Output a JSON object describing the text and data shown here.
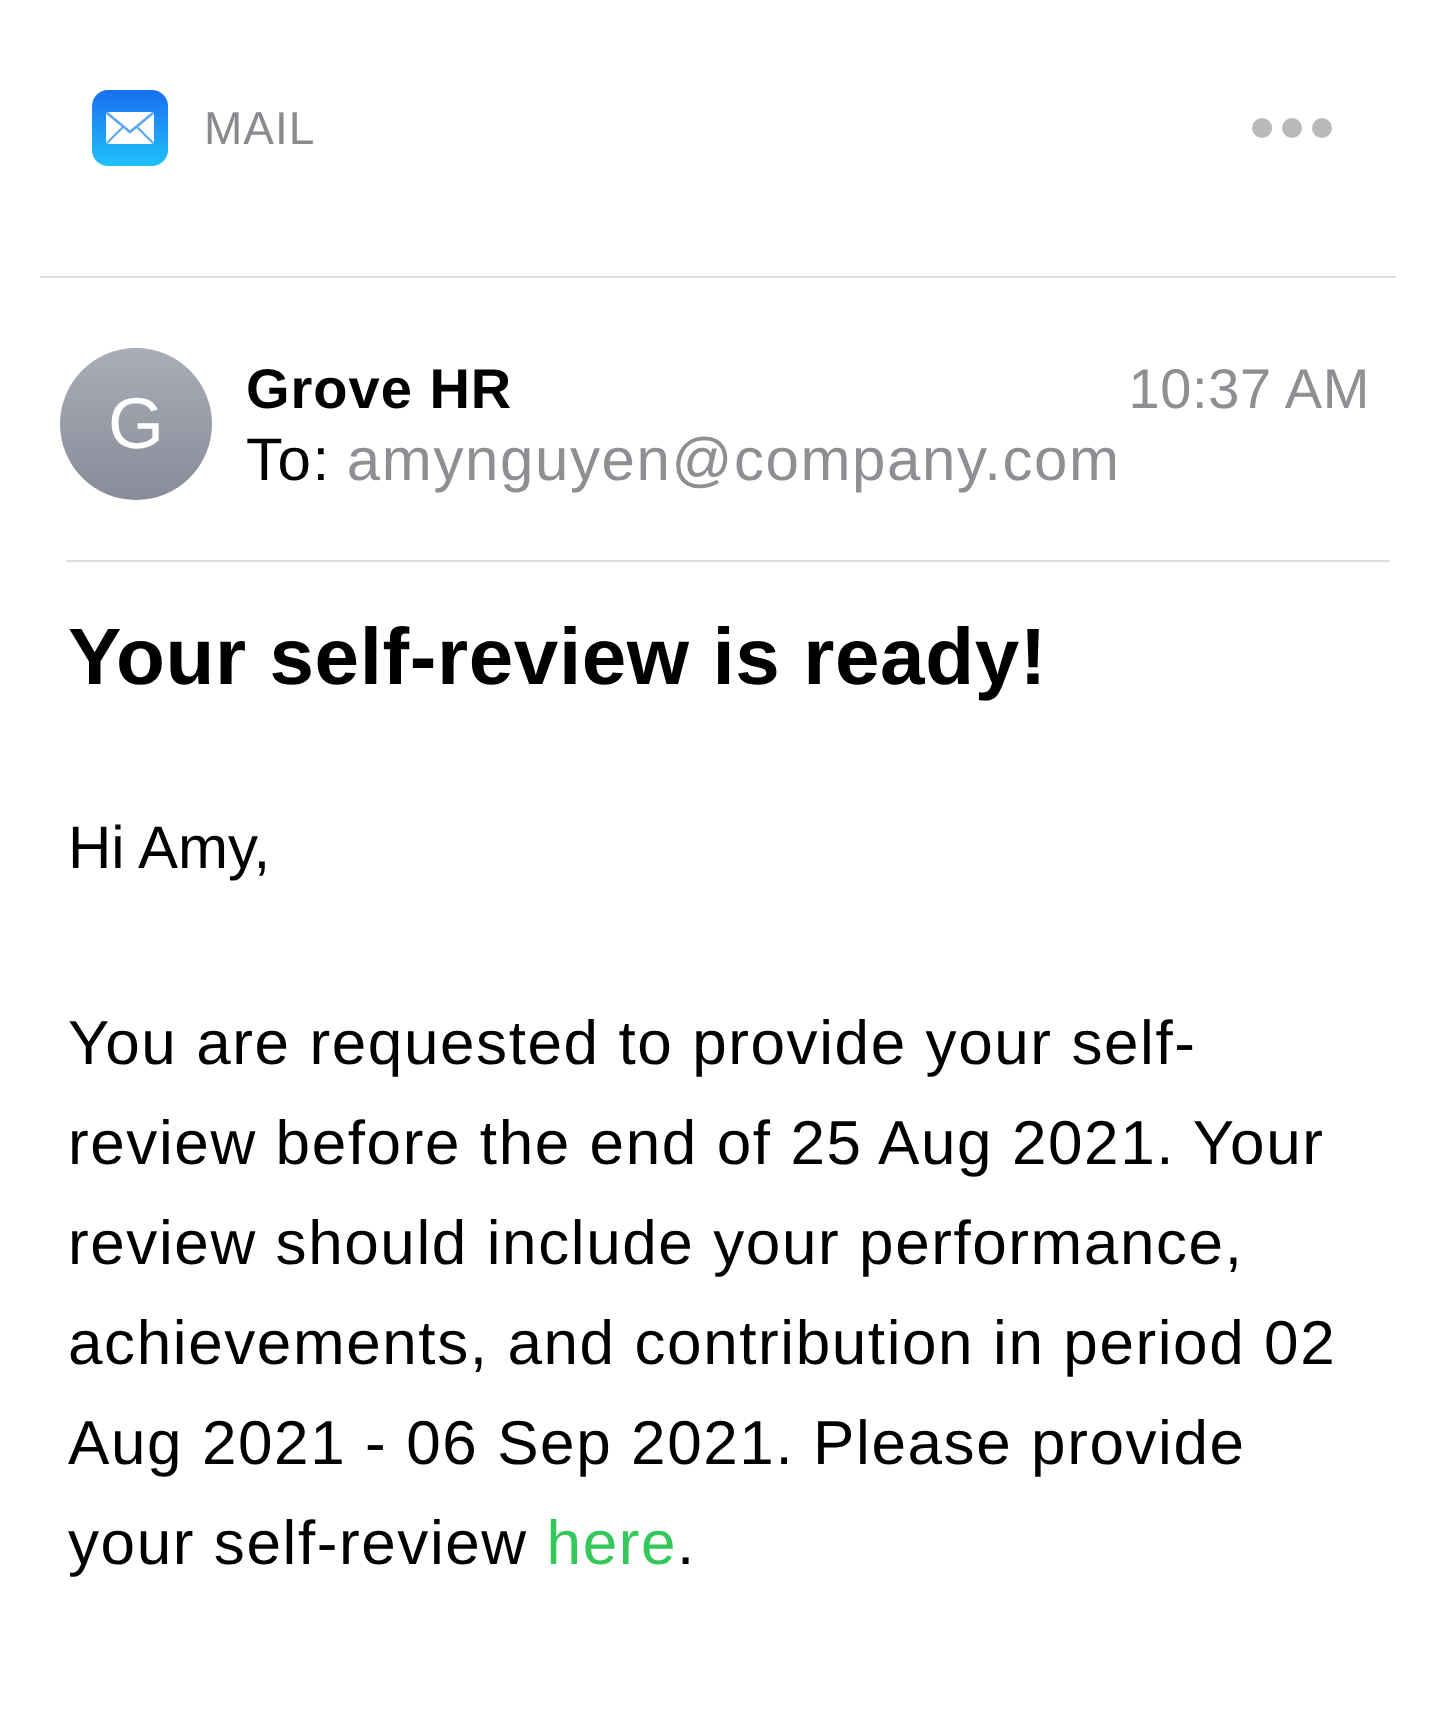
{
  "app_header": {
    "app_name": "MAIL"
  },
  "message": {
    "sender": {
      "initial": "G",
      "name": "Grove HR"
    },
    "time": "10:37 AM",
    "to_label": "To:",
    "to_address": "amynguyen@company.com"
  },
  "body": {
    "subject": "Your self-review is ready!",
    "greeting": "Hi Amy,",
    "paragraph": {
      "text_before": "You are requested to provide your self-review before the end of 25 Aug 2021. Your review should include your performance, achievements, and contribution in period 02 Aug 2021 - 06 Sep 2021. Please provide your self-review",
      "link": "here",
      "text_after": "."
    }
  }
}
